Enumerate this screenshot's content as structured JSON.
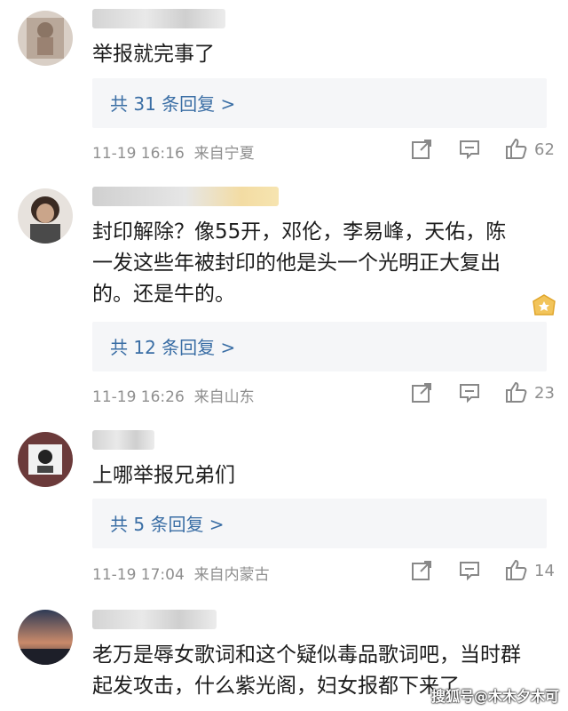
{
  "comments": [
    {
      "text": "举报就完事了",
      "replies": "共 31 条回复 >",
      "date": "11-19 16:16",
      "location": "来自宁夏",
      "likes": "62"
    },
    {
      "text_lines": [
        "封印解除？像55开，邓伦，李易峰，天佑，陈",
        "一发这些年被封印的他是头一个光明正大复出",
        "的。还是牛的。"
      ],
      "replies": "共 12 条回复 >",
      "date": "11-19 16:26",
      "location": "来自山东",
      "likes": "23"
    },
    {
      "text": "上哪举报兄弟们",
      "replies": "共 5 条回复 >",
      "date": "11-19 17:04",
      "location": "来自内蒙古",
      "likes": "14"
    },
    {
      "text_lines": [
        "老万是辱女歌词和这个疑似毒品歌词吧，当时群",
        "起发攻击，什么紫光阁，妇女报都下来了"
      ]
    }
  ],
  "icons": {
    "share": "share-icon",
    "comment": "comment-icon",
    "like": "thumbs-up-icon",
    "badge": "medal-badge-icon"
  },
  "watermark": "搜狐号@木木夕木可",
  "colors": {
    "link": "#3a6ea5",
    "meta": "#8f8f8f",
    "reply_bg": "#f5f6f8"
  }
}
